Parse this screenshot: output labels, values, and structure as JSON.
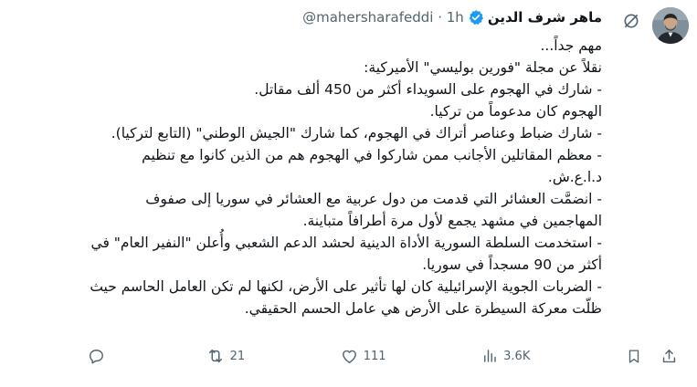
{
  "author": {
    "name": "ماهر شرف الدين",
    "handle": "@mahersharafeddi",
    "separator": "·",
    "time": "1h"
  },
  "tweet": {
    "lines": [
      "مهم جداً...",
      "نقلاً عن مجلة \"فورين بوليسي\" الأميركية:",
      "- شارك في الهجوم على السويداء أكثر من 450 ألف مقاتل.",
      "الهجوم كان مدعوماً من تركيا.",
      "- شارك ضباط وعناصر أتراك في الهجوم، كما شارك \"الجيش الوطني\" (التابع لتركيا).",
      "- معظم المقاتلين الأجانب ممن شاركوا في الهجوم هم من الذين كانوا مع تنظيم",
      "د.ا.ع.ش.",
      "- انضمَّت العشائر التي قدمت من دول عربية مع العشائر في سوريا إلى صفوف",
      "المهاجمين في مشهد يجمع لأول مرة أطرافاً متباينة.",
      "- استخدمت السلطة السورية الأداة الدينية لحشد الدعم الشعبي وأُعلن \"النفير العام\" في",
      "أكثر من 90 مسجداً في سوريا.",
      "- الضربات الجوية الإسرائيلية كان لها تأثير على الأرض، لكنها لم تكن العامل الحاسم حيث",
      "ظلّت معركة السيطرة على الأرض هي عامل الحسم الحقيقي."
    ]
  },
  "actions": {
    "reply_count": "",
    "retweet_count": "21",
    "like_count": "111",
    "views_count": "3.6K"
  },
  "colors": {
    "text": "#0f1419",
    "muted": "#536471",
    "verified": "#1d9bf0"
  },
  "icons": [
    "grok-icon",
    "more-icon",
    "verified-badge-icon",
    "reply-icon",
    "retweet-icon",
    "like-icon",
    "views-icon",
    "bookmark-icon",
    "share-icon"
  ]
}
